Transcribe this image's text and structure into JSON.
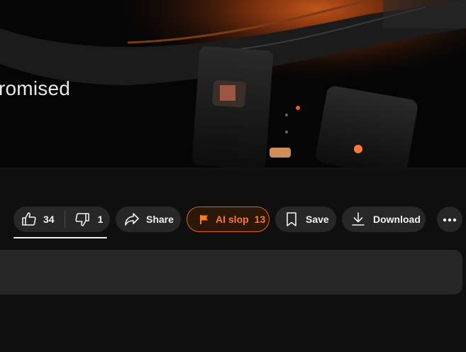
{
  "video": {
    "caption_text": "romised"
  },
  "actions": {
    "like_count": "34",
    "dislike_count": "1",
    "share_label": "Share",
    "flag_label": "AI slop",
    "flag_count": "13",
    "save_label": "Save",
    "download_label": "Download"
  },
  "icons": {
    "like": "thumbs-up-icon",
    "dislike": "thumbs-down-icon",
    "share": "share-arrow-icon",
    "flag": "flag-icon",
    "save": "bookmark-icon",
    "download": "download-icon",
    "more": "more-horizontal-icon"
  },
  "colors": {
    "background": "#0f0f0f",
    "pill": "#272727",
    "flag_accent": "#ff7a1f",
    "flag_border": "#e0621c",
    "text": "#f1f1f1"
  }
}
